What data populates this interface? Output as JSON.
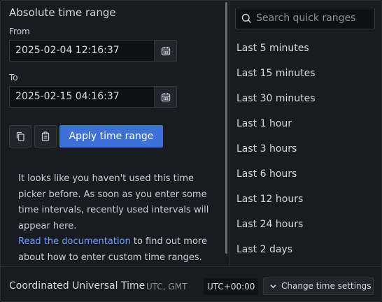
{
  "absolute": {
    "title": "Absolute time range",
    "from_label": "From",
    "from_value": "2025-02-04 12:16:37",
    "to_label": "To",
    "to_value": "2025-02-15 04:16:37",
    "apply_label": "Apply time range",
    "copy_icon": "copy-icon",
    "paste_icon": "clipboard-icon",
    "calendar_icon": "calendar-icon"
  },
  "info": {
    "text": "It looks like you haven't used this time picker before. As soon as you enter some time intervals, recently used intervals will appear here.",
    "link_text": "Read the documentation",
    "link_suffix": " to find out more about how to enter custom time ranges."
  },
  "quick": {
    "search_placeholder": "Search quick ranges",
    "ranges": [
      "Last 5 minutes",
      "Last 15 minutes",
      "Last 30 minutes",
      "Last 1 hour",
      "Last 3 hours",
      "Last 6 hours",
      "Last 12 hours",
      "Last 24 hours",
      "Last 2 days"
    ]
  },
  "footer": {
    "timezone_name": "Coordinated Universal Time",
    "timezone_abbr": "UTC, GMT",
    "offset": "UTC+00:00",
    "change_label": "Change time settings"
  },
  "colors": {
    "background": "#181b1f",
    "primary": "#3d71d9",
    "link": "#6e9fff"
  }
}
